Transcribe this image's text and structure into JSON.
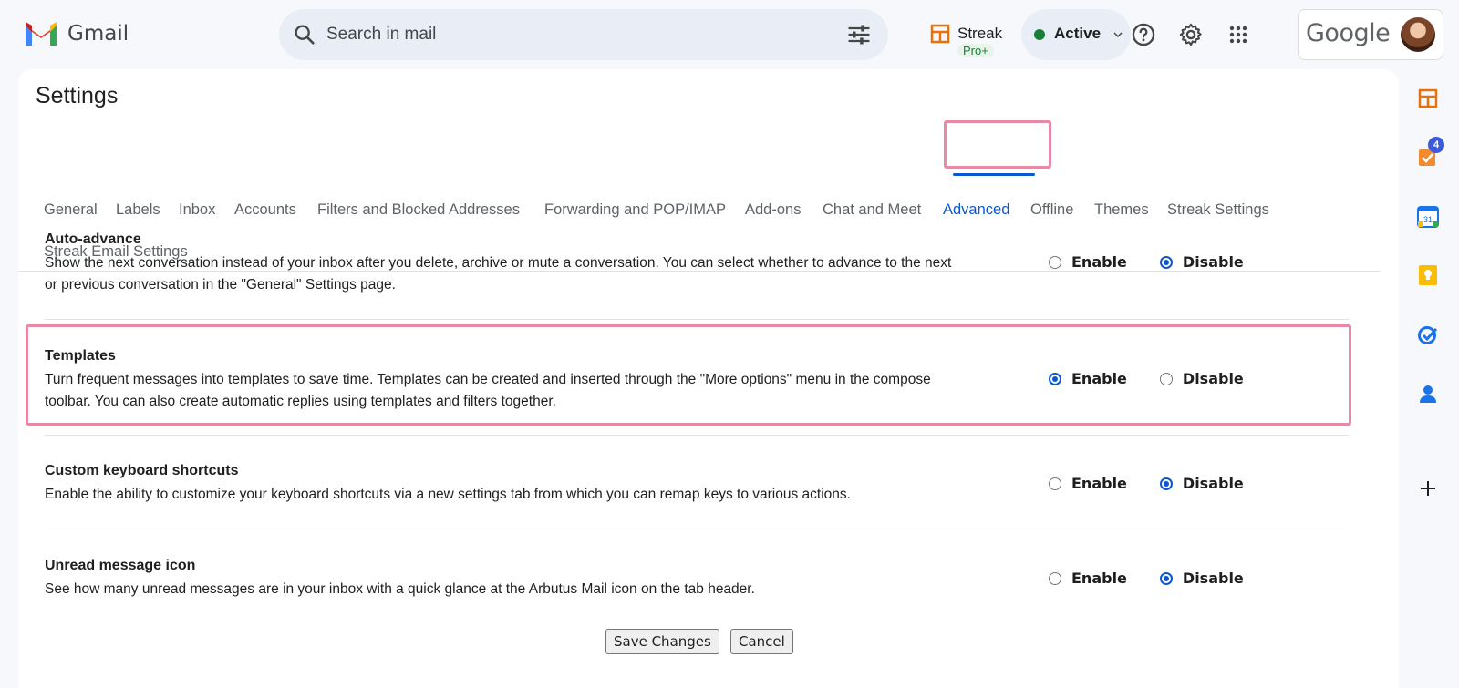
{
  "header": {
    "app_name": "Gmail",
    "search_placeholder": "Search in mail",
    "streak_label": "Streak",
    "streak_badge": "Pro+",
    "status_label": "Active",
    "account_brand": "Google"
  },
  "settings": {
    "title": "Settings",
    "tabs": [
      {
        "label": "General"
      },
      {
        "label": "Labels"
      },
      {
        "label": "Inbox"
      },
      {
        "label": "Accounts"
      },
      {
        "label": "Filters and Blocked Addresses"
      },
      {
        "label": "Forwarding and POP/IMAP"
      },
      {
        "label": "Add-ons"
      },
      {
        "label": "Chat and Meet"
      },
      {
        "label": "Advanced"
      },
      {
        "label": "Offline"
      },
      {
        "label": "Themes"
      },
      {
        "label": "Streak Settings"
      },
      {
        "label": "Streak Email Settings"
      }
    ],
    "active_tab": "Advanced",
    "options": {
      "enable": "Enable",
      "disable": "Disable"
    },
    "items": [
      {
        "title": "Auto-advance",
        "description": "Show the next conversation instead of your inbox after you delete, archive or mute a conversation. You can select whether to advance to the next or previous conversation in the \"General\" Settings page.",
        "selected": "Disable"
      },
      {
        "title": "Templates",
        "description": "Turn frequent messages into templates to save time. Templates can be created and inserted through the \"More options\" menu in the compose toolbar. You can also create automatic replies using templates and filters together.",
        "selected": "Enable"
      },
      {
        "title": "Custom keyboard shortcuts",
        "description": "Enable the ability to customize your keyboard shortcuts via a new settings tab from which you can remap keys to various actions.",
        "selected": "Disable"
      },
      {
        "title": "Unread message icon",
        "description": "See how many unread messages are in your inbox with a quick glance at the Arbutus Mail icon on the tab header.",
        "selected": "Disable"
      }
    ],
    "save_label": "Save Changes",
    "cancel_label": "Cancel"
  },
  "side_rail": {
    "tasks_badge": "4",
    "calendar_day": "31"
  },
  "colors": {
    "accent": "#0b57d0",
    "highlight": "#e88aa6",
    "status_green": "#188038"
  }
}
